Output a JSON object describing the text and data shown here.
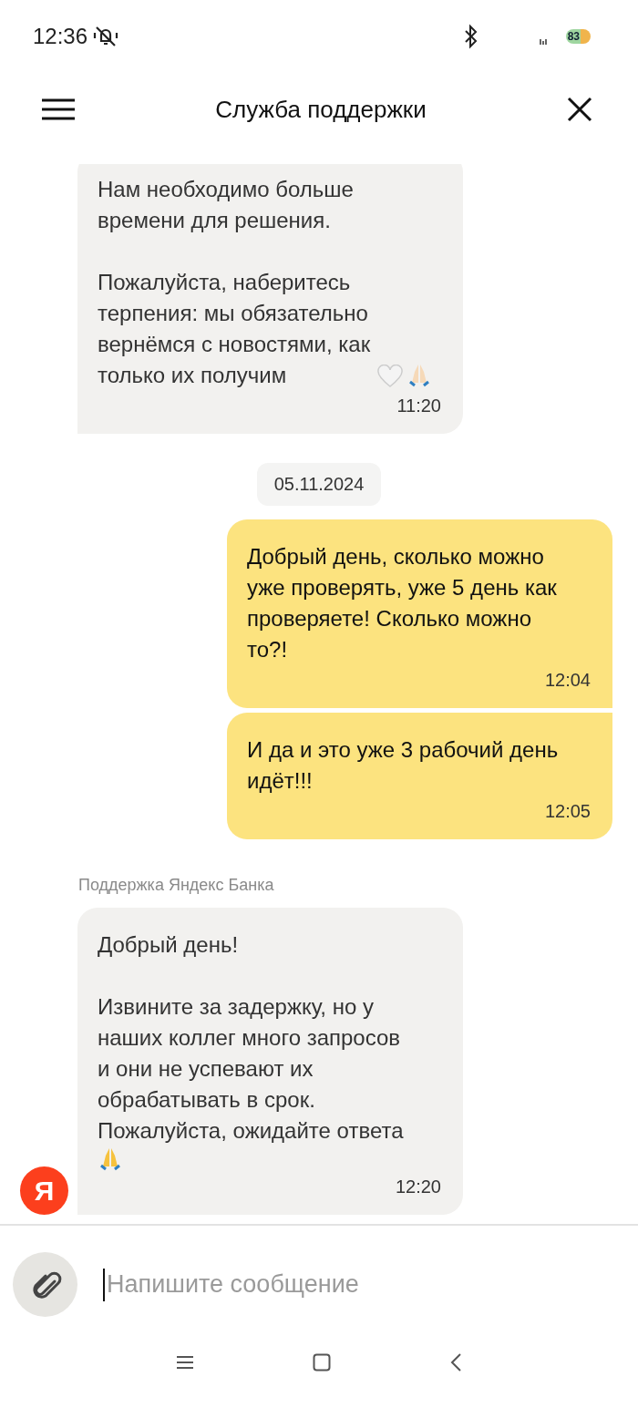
{
  "status_bar": {
    "time": "12:36",
    "battery": "83"
  },
  "header": {
    "title": "Служба поддержки"
  },
  "messages": [
    {
      "kind": "incoming",
      "paragraphs": [
        "Нам необходимо больше\nвремени для решения.",
        "Пожалуйста, наберитесь\nтерпения: мы обязательно\nвернёмся с новостями, как\nтолько их получим"
      ],
      "trailing_icons": [
        {
          "kind": "heart"
        },
        {
          "kind": "praying-hands"
        }
      ],
      "time": "11:20"
    },
    {
      "kind": "date",
      "label": "05.11.2024"
    },
    {
      "kind": "outgoing",
      "paragraphs": [
        "Добрый день, сколько можно\nуже проверять, уже 5 день как\nпроверяете! Сколько можно\nто?!"
      ],
      "time": "12:04"
    },
    {
      "kind": "outgoing",
      "paragraphs": [
        "И да и это уже 3 рабочий день\nидёт!!!"
      ],
      "time": "12:05"
    },
    {
      "kind": "incoming",
      "sender": "Поддержка Яндекс Банка",
      "paragraphs": [
        "Добрый день!",
        "Извините за задержку, но у\nнаших коллег много запросов\nи они не успевают их\nобрабатывать в срок.\nПожалуйста, ожидайте ответа"
      ],
      "trailing_icons": [
        {
          "kind": "praying-hands"
        }
      ],
      "icons_on_new_line": true,
      "time": "12:20",
      "avatar": "Я"
    }
  ],
  "composer": {
    "placeholder": "Напишите сообщение"
  }
}
